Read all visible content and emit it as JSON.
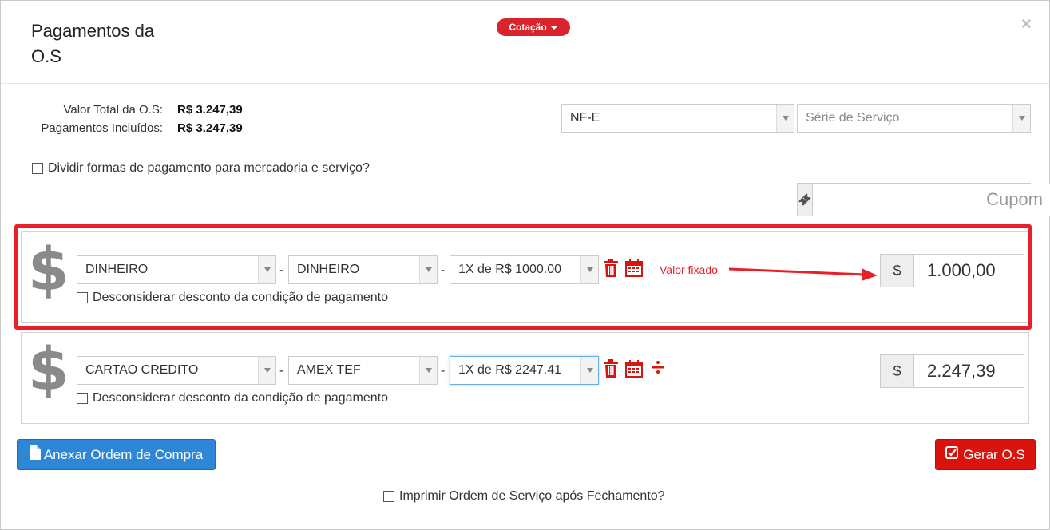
{
  "header": {
    "title": "Pagamentos da O.S",
    "cotacao_label": "Cotação",
    "close_symbol": "×"
  },
  "totals": {
    "total_label": "Valor Total da O.S:",
    "total_value": "R$ 3.247,39",
    "included_label": "Pagamentos Incluídos:",
    "included_value": "R$ 3.247,39"
  },
  "invoice": {
    "type_value": "NF-E",
    "series_placeholder": "Série de Serviço"
  },
  "split_checkbox_label": "Dividir formas de pagamento para mercadoria e serviço?",
  "cupom": {
    "placeholder": "Cupom"
  },
  "payments": [
    {
      "method": "DINHEIRO",
      "submethod": "DINHEIRO",
      "installments": "1X de R$ 1000.00",
      "discount_label": "Desconsiderar desconto da condição de pagamento",
      "currency": "$",
      "amount": "1.000,00"
    },
    {
      "method": "CARTAO CREDITO",
      "submethod": "AMEX TEF",
      "installments": "1X de R$ 2247.41",
      "discount_label": "Desconsiderar desconto da condição de pagamento",
      "currency": "$",
      "amount": "2.247,39"
    }
  ],
  "dash": "-",
  "dollar_icon": "$",
  "annotation": "Valor fixado",
  "buttons": {
    "attach": "Anexar Ordem de Compra",
    "generate": "Gerar O.S"
  },
  "print_checkbox_label": "Imprimir Ordem de Serviço após Fechamento?",
  "colors": {
    "accent_red": "#e8202a",
    "primary_blue": "#2d86d6",
    "danger_red": "#d9140e"
  }
}
